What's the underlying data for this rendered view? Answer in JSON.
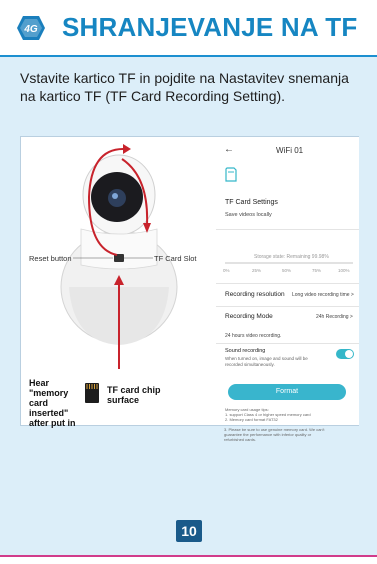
{
  "header": {
    "title": "SHRANJEVANJE NA TF",
    "logo_text": "4G"
  },
  "intro": "Vstavite kartico TF in pojdite na Nastavitev snemanja na kartico TF (TF Card Recording Setting).",
  "camera": {
    "reset_label": "Reset button",
    "slot_label": "TF Card Slot",
    "hear_label": "Hear \"memory card inserted\" after put in",
    "tf_label": "TF card chip surface"
  },
  "phone": {
    "back": "←",
    "device_title": "WiFi 01",
    "settings_title": "TF Card Settings",
    "settings_sub": "Save videos locally",
    "storage": "Storage state: Remaining 99.98%",
    "scale": [
      "0%",
      "25%",
      "50%",
      "75%",
      "100%"
    ],
    "res_label": "Recording resolution",
    "res_value": "Long video recording time >",
    "mode_label": "Recording Mode",
    "mode_value": "24h Recording >",
    "mode_note": "24 hours video recording.",
    "sound_title": "Sound recording",
    "sound_desc": "When turned on, image and sound will be recorded simultaneously.",
    "format_label": "Format",
    "tips": [
      "Memory card usage tips:",
      "1. support Class 4 or higher speed memory card",
      "2. Memory card format FAT32",
      "3. Please be sure to use genuine memory card. We can't",
      "guarantee the performance with inferior quality or",
      "refurbished cards."
    ]
  },
  "page_number": "10",
  "colors": {
    "title": "#1686c2",
    "band": "#dceef9",
    "accent": "#39b5cd",
    "page_badge": "#1a5a8a",
    "bottom_rule": "#d13b8b"
  }
}
